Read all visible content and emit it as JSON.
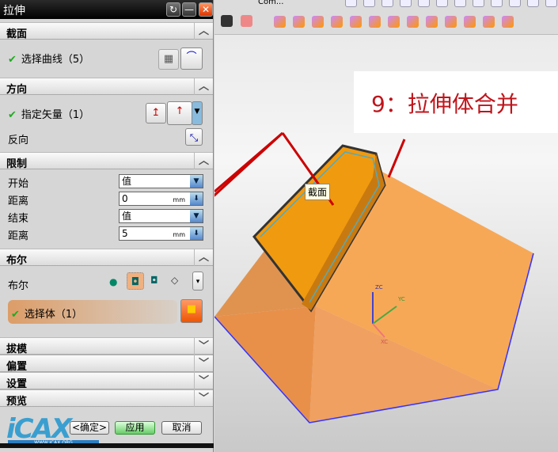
{
  "dialog": {
    "title": "拉伸",
    "sections": {
      "section": {
        "title": "截面",
        "select_curve": "选择曲线（5）"
      },
      "direction": {
        "title": "方向",
        "specify_vector": "指定矢量（1）",
        "reverse": "反向"
      },
      "limits": {
        "title": "限制",
        "start_label": "开始",
        "start_value": "值",
        "dist1_label": "距离",
        "dist1_value": "0",
        "unit": "mm",
        "end_label": "结束",
        "end_value": "值",
        "dist2_label": "距离",
        "dist2_value": "5"
      },
      "boolean": {
        "title": "布尔",
        "label": "布尔",
        "select_body": "选择体（1）"
      },
      "draft": {
        "title": "拔模"
      },
      "offset": {
        "title": "偏置"
      },
      "settings": {
        "title": "设置"
      },
      "preview": {
        "title": "预览"
      }
    },
    "buttons": {
      "ok": "<确定>",
      "apply": "应用",
      "cancel": "取消"
    },
    "watermark": "WWW.ICAX.ORG"
  },
  "toolbar": {
    "command_text": "Com..."
  },
  "viewport": {
    "callout": "9：拉伸体合并",
    "tooltip": "截面",
    "axes": {
      "z": "ZC",
      "y": "YC",
      "x": "XC"
    }
  }
}
